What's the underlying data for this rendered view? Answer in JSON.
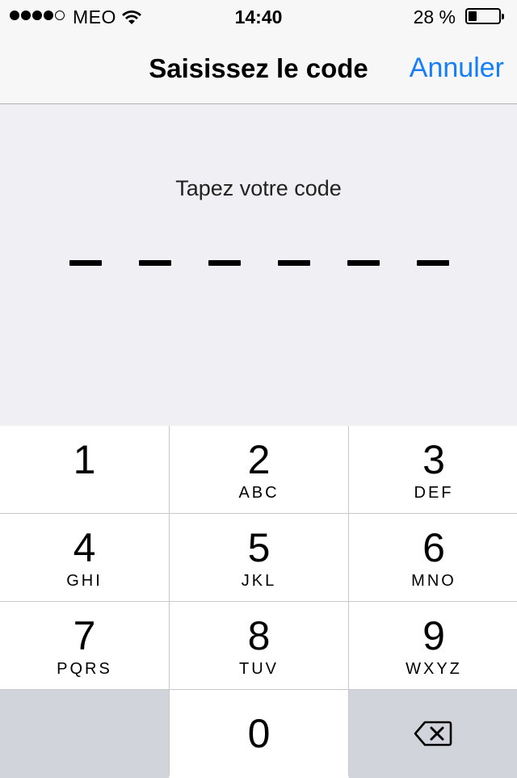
{
  "status_bar": {
    "carrier": "MEO",
    "time": "14:40",
    "battery_percent": "28 %",
    "battery_level": 0.28,
    "signal_strength": 4,
    "signal_max": 5
  },
  "nav": {
    "title": "Saisissez le code",
    "cancel_label": "Annuler",
    "accent_color": "#157efb"
  },
  "prompt": "Tapez votre code",
  "code": {
    "length": 6,
    "entered": 0
  },
  "keypad": {
    "keys": [
      {
        "digit": "1",
        "letters": ""
      },
      {
        "digit": "2",
        "letters": "ABC"
      },
      {
        "digit": "3",
        "letters": "DEF"
      },
      {
        "digit": "4",
        "letters": "GHI"
      },
      {
        "digit": "5",
        "letters": "JKL"
      },
      {
        "digit": "6",
        "letters": "MNO"
      },
      {
        "digit": "7",
        "letters": "PQRS"
      },
      {
        "digit": "8",
        "letters": "TUV"
      },
      {
        "digit": "9",
        "letters": "WXYZ"
      },
      {
        "digit": "0",
        "letters": ""
      }
    ],
    "delete_icon": "delete-backspace-icon"
  }
}
